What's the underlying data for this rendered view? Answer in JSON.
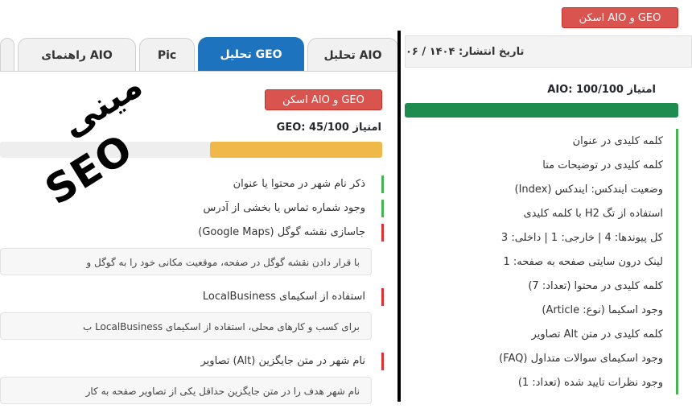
{
  "right_panel": {
    "scan_button_label": "اسکن AIO و GEO",
    "publish_date": "تاریخ انتشار: ۱۴۰۴ / ۰۶",
    "aio_score_label": "امتیاز AIO: 100/100",
    "aio_score_fraction": 1.0,
    "checks": [
      "کلمه کلیدی در عنوان",
      "کلمه کلیدی در توضیحات متا",
      "وضعیت ایندکس: ایندکس (Index)",
      "استفاده از تگ H2 با کلمه کلیدی",
      "کل پیوندها: 4 | خارجی: 1 | داخلی: 3",
      "لینک درون سایتی صفحه به صفحه: 1",
      "کلمه کلیدی در محتوا (تعداد: 7)",
      "وجود اسکیما (نوع: Article)",
      "کلمه کلیدی در متن Alt تصاویر",
      "وجود اسکیمای سوالات متداول (FAQ)",
      "وجود نظرات تایید شده (تعداد: 1)"
    ]
  },
  "tabs": [
    {
      "label": "تحلیل AIO"
    },
    {
      "label": "تحلیل GEO"
    },
    {
      "label": "Pic"
    },
    {
      "label": "راهنمای AIO"
    }
  ],
  "left_panel": {
    "scan_button_label": "اسکن AIO و GEO",
    "geo_score_label": "امتیاز GEO: 45/100",
    "geo_score_fraction": 0.45,
    "items": [
      {
        "label": "ذکر نام شهر در محتوا یا عنوان",
        "status": "ok"
      },
      {
        "label": "وجود شماره تماس یا بخشی از آدرس",
        "status": "ok"
      },
      {
        "label": "جاسازی نقشه گوگل (Google Maps)",
        "status": "bad",
        "tip": "با قرار دادن نقشه گوگل در صفحه، موقعیت مکانی خود را به گوگل و"
      },
      {
        "label": "استفاده از اسکیمای LocalBusiness",
        "status": "bad",
        "tip": "برای کسب و کارهای محلی، استفاده از اسکیمای LocalBusiness ب"
      },
      {
        "label": "نام شهر در متن جایگزین (Alt) تصاویر",
        "status": "bad",
        "tip": "نام شهر هدف را در متن جایگزین حداقل یکی از تصاویر صفحه به کار"
      }
    ]
  },
  "stamp": {
    "word1": "مینی",
    "word2": "SEO"
  }
}
